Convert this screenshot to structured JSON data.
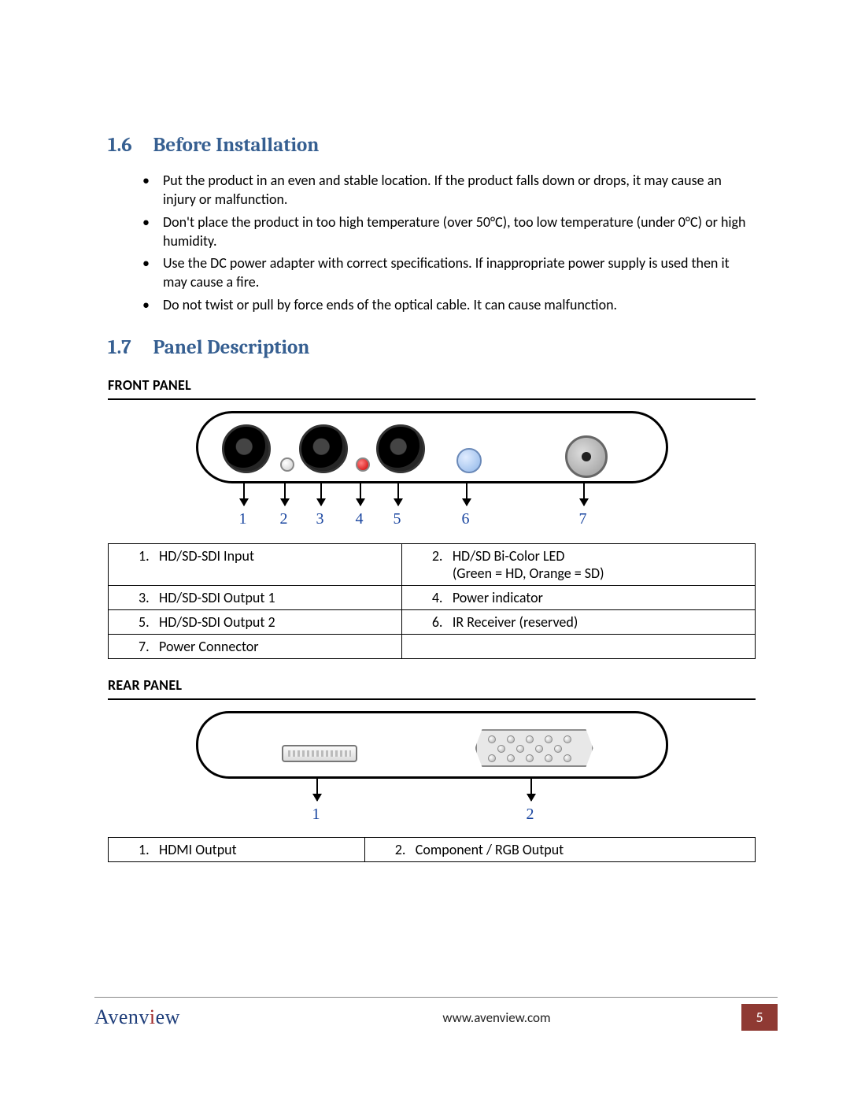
{
  "section16": {
    "num": "1.6",
    "title": "Before Installation"
  },
  "bullets16": [
    "Put the product in an even and stable location. If the product falls down or drops, it may cause an injury or malfunction.",
    "Don't place the product in too high temperature (over 50°C), too low temperature (under 0°C) or high humidity.",
    "Use the DC power adapter with correct specifications. If inappropriate power supply is used then it may cause a fire.",
    "Do not twist or pull by force ends of the optical cable. It can cause malfunction."
  ],
  "section17": {
    "num": "1.7",
    "title": "Panel Description"
  },
  "front": {
    "heading": "FRONT PANEL",
    "labels": [
      "1",
      "2",
      "3",
      "4",
      "5",
      "6",
      "7"
    ],
    "items": [
      {
        "n": "1.",
        "t": "HD/SD-SDI Input"
      },
      {
        "n": "2.",
        "t": "HD/SD Bi-Color LED",
        "sub": "(Green = HD, Orange = SD)"
      },
      {
        "n": "3.",
        "t": "HD/SD-SDI Output 1"
      },
      {
        "n": "4.",
        "t": "Power indicator"
      },
      {
        "n": "5.",
        "t": "HD/SD-SDI Output 2"
      },
      {
        "n": "6.",
        "t": "IR Receiver (reserved)"
      },
      {
        "n": "7.",
        "t": "Power Connector"
      }
    ]
  },
  "rear": {
    "heading": "REAR PANEL",
    "labels": [
      "1",
      "2"
    ],
    "items": [
      {
        "n": "1.",
        "t": "HDMI Output"
      },
      {
        "n": "2.",
        "t": "Component / RGB Output"
      }
    ]
  },
  "footer": {
    "brand": "Avenview",
    "site": "www.avenview.com",
    "page": "5"
  }
}
